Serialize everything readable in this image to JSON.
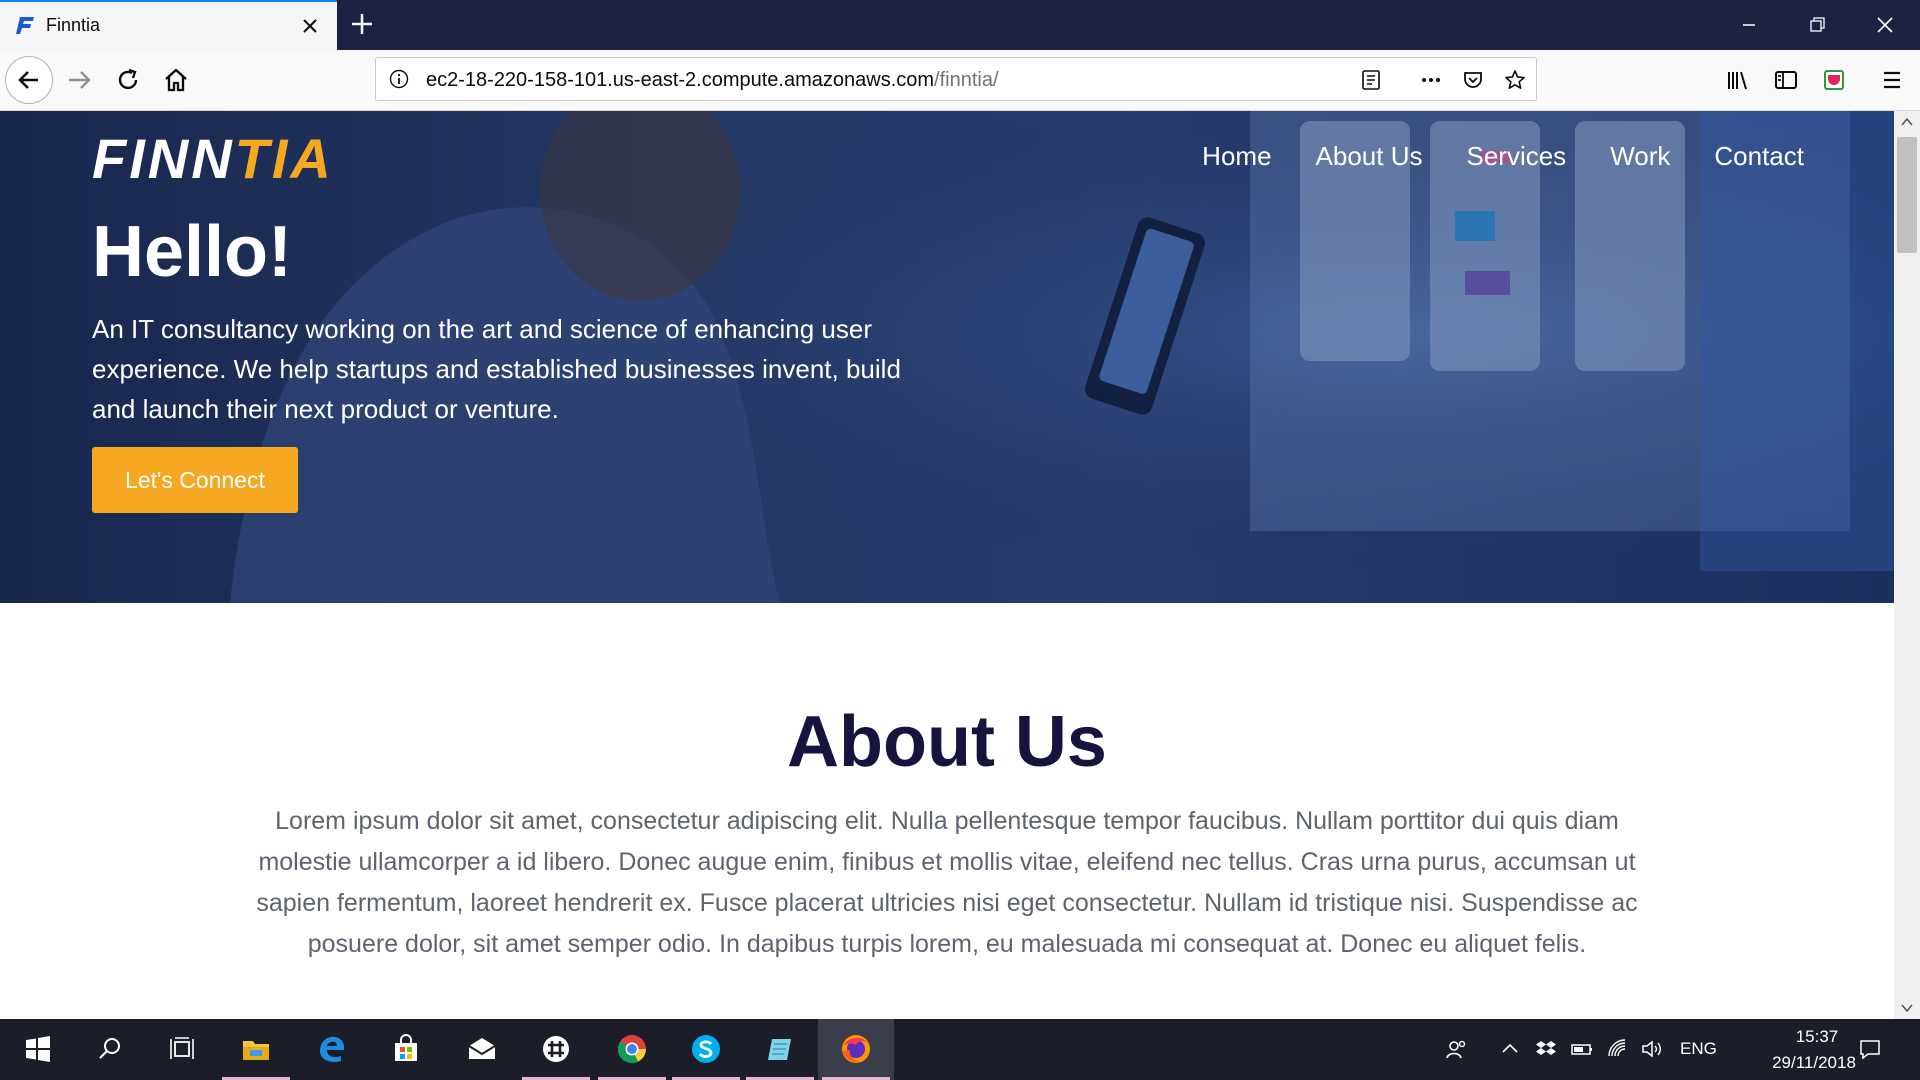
{
  "browser": {
    "tab_title": "Finntia",
    "url_host": "ec2-18-220-158-101.us-east-2.compute.amazonaws.com",
    "url_path": "/finntia/"
  },
  "site": {
    "logo_part1": "FINN",
    "logo_part2": "TIA",
    "nav": [
      "Home",
      "About Us",
      "Services",
      "Work",
      "Contact"
    ],
    "hero_title": "Hello!",
    "hero_text": "An IT consultancy working on the art and science of enhancing user experience. We help startups and established businesses invent, build and launch their next product or venture.",
    "cta_label": "Let's Connect",
    "about_title": "About Us",
    "about_text": "Lorem ipsum dolor sit amet, consectetur adipiscing elit. Nulla pellentesque tempor faucibus. Nullam porttitor dui quis diam molestie ullamcorper a id libero. Donec augue enim, finibus et mollis vitae, eleifend nec tellus. Cras urna purus, accumsan ut sapien fermentum, laoreet hendrerit ex. Fusce placerat ultricies nisi eget consectetur. Nullam id tristique nisi. Suspendisse ac posuere dolor, sit amet semper odio. In dapibus turpis lorem, eu malesuada mi consequat at. Donec eu aliquet felis."
  },
  "colors": {
    "accent": "#f7a823",
    "heading": "#16143e",
    "hero_overlay": "#1f3566"
  },
  "taskbar": {
    "apps": [
      "start-icon",
      "search-icon",
      "task-view-icon",
      "file-explorer-icon",
      "edge-icon",
      "store-icon",
      "mail-icon",
      "slack-icon",
      "chrome-icon",
      "skype-icon",
      "notepad-icon",
      "firefox-icon"
    ],
    "language": "ENG",
    "time": "15:37",
    "date": "29/11/2018"
  }
}
